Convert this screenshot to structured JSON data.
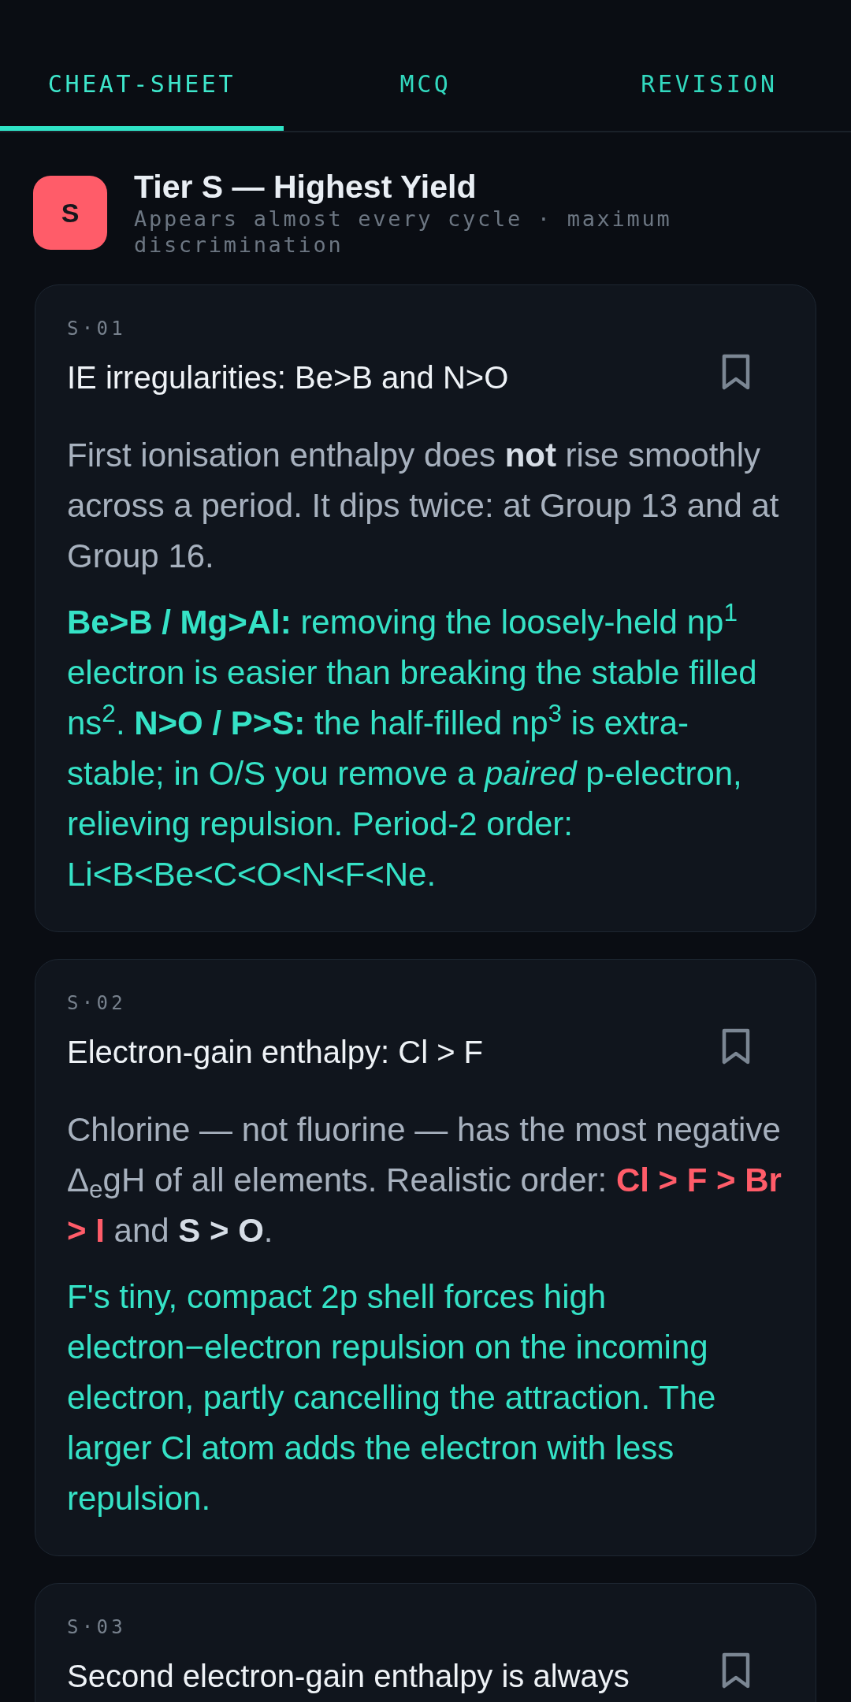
{
  "tabs": [
    {
      "label": "CHEAT-SHEET",
      "selected": true
    },
    {
      "label": "MCQ",
      "selected": false
    },
    {
      "label": "REVISION",
      "selected": false
    }
  ],
  "tier": {
    "badge": "S",
    "title": "Tier S — Highest Yield",
    "subtitle": "Appears almost every cycle · maximum discrimination"
  },
  "cards": [
    {
      "code": "S·01",
      "title": "IE irregularities: Be>B and N>O",
      "bookmarked": false,
      "paragraphs": [
        {
          "kind": "body",
          "runs": [
            {
              "kind": "plain",
              "text": "First ionisation enthalpy does **not** rise smoothly across a period. It dips twice: at Group 13 and at Group 16."
            }
          ]
        },
        {
          "kind": "insight",
          "runs": [
            {
              "kind": "plain",
              "text": "**Be>B / Mg>Al:** removing the loosely-held np$^{1}$ electron is easier than breaking the stable filled ns$^{2}$. **N>O / P>S:** the half-filled np$^{3}$ is extra-stable; in O/S you remove a *paired* p-electron, relieving repulsion. Period-2 order: Li<B<Be<C<O<N<F<Ne."
            }
          ]
        }
      ]
    },
    {
      "code": "S·02",
      "title": "Electron-gain enthalpy: Cl > F",
      "bookmarked": false,
      "paragraphs": [
        {
          "kind": "body",
          "runs": [
            {
              "kind": "plain",
              "text": "Chlorine — not fluorine — has the most negative Δ$_{e}$gH of all elements. Realistic order: "
            },
            {
              "kind": "danger",
              "text": "Cl > F > Br > I"
            },
            {
              "kind": "plain",
              "text": " and **S > O**."
            }
          ]
        },
        {
          "kind": "insight",
          "runs": [
            {
              "kind": "plain",
              "text": "F's tiny, compact 2p shell forces high electron−electron repulsion on the incoming electron, partly cancelling the attraction. The larger Cl atom adds the electron with less repulsion."
            }
          ]
        }
      ]
    },
    {
      "code": "S·03",
      "title": "Second electron-gain enthalpy is always",
      "bookmarked": false
    }
  ]
}
